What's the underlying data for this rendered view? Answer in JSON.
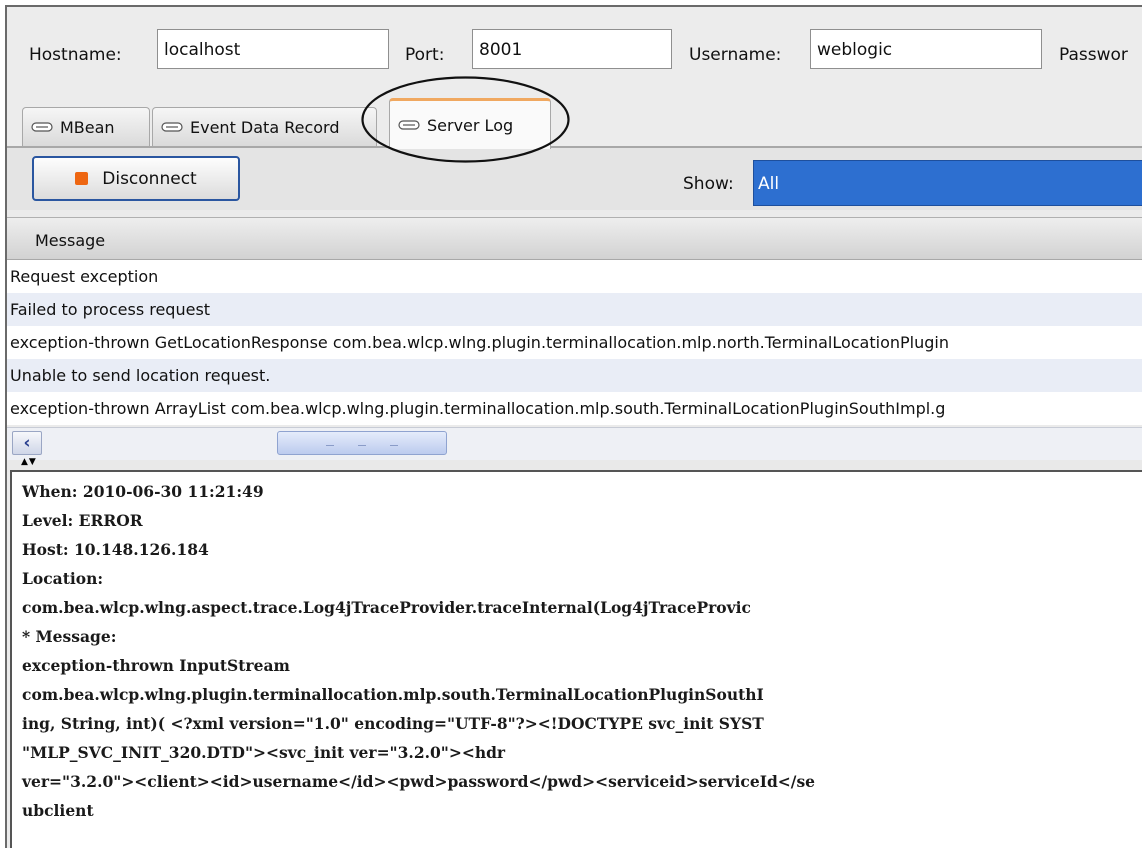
{
  "connection": {
    "hostname_label": "Hostname:",
    "hostname_value": "localhost",
    "port_label": "Port:",
    "port_value": "8001",
    "username_label": "Username:",
    "username_value": "weblogic",
    "password_label": "Passwor"
  },
  "tabs": [
    {
      "label": "MBean",
      "icon": "plug-icon",
      "active": false
    },
    {
      "label": "Event Data Record",
      "icon": "plug-icon",
      "active": false
    },
    {
      "label": "Server Log",
      "icon": "plug-icon",
      "active": true
    }
  ],
  "toolbar": {
    "disconnect_label": "Disconnect",
    "show_label": "Show:",
    "show_value": "All"
  },
  "table": {
    "header": "Message",
    "rows": [
      "Request exception",
      "Failed to process request",
      "exception-thrown GetLocationResponse com.bea.wlcp.wlng.plugin.terminallocation.mlp.north.TerminalLocationPlugin",
      "Unable to send location request.",
      "exception-thrown ArrayList com.bea.wlcp.wlng.plugin.terminallocation.mlp.south.TerminalLocationPluginSouthImpl.g"
    ]
  },
  "detail": {
    "lines": [
      "When: 2010-06-30 11:21:49",
      "Level: ERROR",
      "Host: 10.148.126.184",
      "Location:",
      "com.bea.wlcp.wlng.aspect.trace.Log4jTraceProvider.traceInternal(Log4jTraceProvic",
      "* Message:",
      "exception-thrown InputStream",
      "com.bea.wlcp.wlng.plugin.terminallocation.mlp.south.TerminalLocationPluginSouthI",
      "ing, String, int)( <?xml version=\"1.0\" encoding=\"UTF-8\"?><!DOCTYPE svc_init SYST",
      "\"MLP_SVC_INIT_320.DTD\"><svc_init ver=\"3.2.0\"><hdr",
      "ver=\"3.2.0\"><client><id>username</id><pwd>password</pwd><serviceid>serviceId</se",
      "ubclient"
    ]
  },
  "colors": {
    "accent": "#2d6fd0",
    "stop_icon": "#ee6611",
    "active_tab_top": "#f0a860"
  }
}
